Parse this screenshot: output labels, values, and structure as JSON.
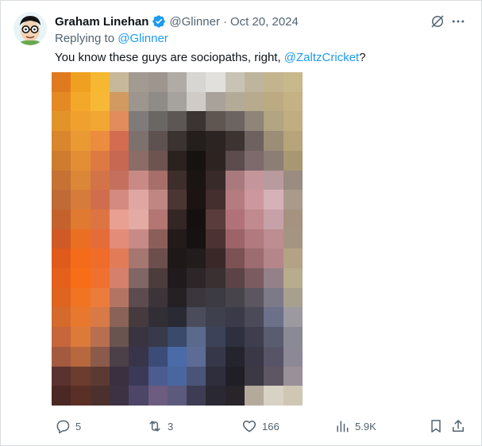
{
  "post": {
    "author_name": "Graham Linehan",
    "handle": "@Glinner",
    "separator": "·",
    "date": "Oct 20, 2024",
    "reply_prefix": "Replying to",
    "reply_to": "@Glinner",
    "text_before_mention": "You know these guys are sociopaths, right,",
    "mention": "@ZaltzCricket",
    "text_after_mention": "?"
  },
  "actions": {
    "replies": "5",
    "reposts": "3",
    "likes": "166",
    "views": "5.9K"
  },
  "icons": {
    "verified": "verified-badge-icon",
    "grok": "grok-icon",
    "more": "more-icon",
    "reply": "reply-icon",
    "repost": "repost-icon",
    "like": "heart-icon",
    "views": "views-icon",
    "bookmark": "bookmark-icon",
    "share": "share-icon"
  },
  "colors": {
    "accent": "#1d9bf0",
    "text": "#0f1419",
    "secondary": "#536471"
  },
  "media": {
    "description_pixel_colors": [
      [
        "#e07a1f",
        "#f0a020",
        "#f5b830",
        "#c8b89a",
        "#a39a92",
        "#9e968e",
        "#b0aca5",
        "#d8d6d2",
        "#e2e0dc",
        "#c9c3b5",
        "#bfb49d",
        "#c4b48e",
        "#c9b88c"
      ],
      [
        "#e58a23",
        "#f3a82a",
        "#f7b836",
        "#d29a60",
        "#9c968f",
        "#8f8b86",
        "#a6a39e",
        "#cfccc7",
        "#a8a29a",
        "#b3ab97",
        "#b7aa8d",
        "#bcaa82",
        "#c4b285"
      ],
      [
        "#e39428",
        "#f0a02e",
        "#f2a634",
        "#e28c5c",
        "#7f7b7a",
        "#6a6664",
        "#5c5654",
        "#3a3432",
        "#5f5652",
        "#6c6460",
        "#8e8477",
        "#b3a482",
        "#c0ae80"
      ],
      [
        "#d9862c",
        "#e99a32",
        "#ec8c3e",
        "#d46c50",
        "#7d716e",
        "#5d5250",
        "#3a3330",
        "#241e1c",
        "#2b2422",
        "#3d3432",
        "#6d6260",
        "#9c8e76",
        "#b8a47a"
      ],
      [
        "#cf7c2e",
        "#e38e34",
        "#dd7a44",
        "#c66852",
        "#8c6c66",
        "#6d5450",
        "#2b2220",
        "#161210",
        "#2d2422",
        "#5c4c4e",
        "#7d6a6c",
        "#8c7e74",
        "#a89872"
      ],
      [
        "#c67234",
        "#dc8638",
        "#d37448",
        "#c5705e",
        "#c98a86",
        "#a86e6a",
        "#3d2e2c",
        "#1a1412",
        "#382a28",
        "#a87a7e",
        "#c4969c",
        "#b99a9e",
        "#9a8c80"
      ],
      [
        "#c06a36",
        "#d67c3a",
        "#cf6e4c",
        "#d48a7e",
        "#e0a6a2",
        "#c08682",
        "#4c3634",
        "#1c1412",
        "#442e2e",
        "#b47c80",
        "#cc989e",
        "#d6b2b8",
        "#aa9a8c"
      ],
      [
        "#c4622e",
        "#e07a30",
        "#dd7444",
        "#e8a092",
        "#e4aaa4",
        "#b47672",
        "#332624",
        "#141010",
        "#5a3c3c",
        "#b07278",
        "#c08a8e",
        "#c6a2a8",
        "#a69280"
      ],
      [
        "#cf5a26",
        "#ea6f22",
        "#e56c3a",
        "#e48c7a",
        "#c88a86",
        "#8c5e5a",
        "#231a1a",
        "#161212",
        "#4c3232",
        "#9c6468",
        "#b07a7e",
        "#bc8e92",
        "#a69482"
      ],
      [
        "#e05a1c",
        "#f46c1a",
        "#ef6c2a",
        "#e27c58",
        "#a67670",
        "#6c4e4c",
        "#1e1818",
        "#221c1c",
        "#3a2828",
        "#7c5254",
        "#9c6c70",
        "#b4868a",
        "#b4a286"
      ],
      [
        "#e4601c",
        "#f76e16",
        "#f07030",
        "#d4806c",
        "#806664",
        "#4c3c3c",
        "#201a1c",
        "#2c2628",
        "#3a3032",
        "#5c4446",
        "#7a5c60",
        "#948088",
        "#b8ac8e"
      ],
      [
        "#de6420",
        "#f07422",
        "#ec7c3c",
        "#b47464",
        "#5c4c50",
        "#3c3438",
        "#242024",
        "#3a363c",
        "#3c3a42",
        "#48444c",
        "#5c5660",
        "#7c7a88",
        "#a8a08e"
      ],
      [
        "#d46a2c",
        "#e8782e",
        "#d87a48",
        "#8a6258",
        "#463a3e",
        "#322e36",
        "#2a2a34",
        "#4a4c5c",
        "#3e404e",
        "#3a3a48",
        "#4a4a58",
        "#6c7088",
        "#9c9aa0"
      ],
      [
        "#c6663a",
        "#dc7a3a",
        "#b86e50",
        "#6a5450",
        "#3a3440",
        "#363a4a",
        "#3a4a6a",
        "#5a6a8c",
        "#3c4258",
        "#2e3040",
        "#3e3e4e",
        "#5a5c70",
        "#8a8a96"
      ],
      [
        "#a45a3e",
        "#b8683e",
        "#8c5a4a",
        "#4c4048",
        "#38344a",
        "#3c4c78",
        "#4a6aa8",
        "#5c6c94",
        "#36384a",
        "#24242e",
        "#3a3846",
        "#565466",
        "#8c8896"
      ],
      [
        "#5a3230",
        "#6c3c2e",
        "#5c3a34",
        "#3a3040",
        "#3a3a58",
        "#4c5c90",
        "#4a66a0",
        "#4a5478",
        "#2e2e3c",
        "#201e26",
        "#3c3844",
        "#5e5662",
        "#9a909a"
      ],
      [
        "#4a2824",
        "#5a3026",
        "#4c302c",
        "#3c3244",
        "#4e4668",
        "#6c5c80",
        "#5c5a7c",
        "#3e3c52",
        "#2a2832",
        "#28242a",
        "#b4aa9c",
        "#d8d2c4",
        "#cfc7b4"
      ]
    ]
  }
}
